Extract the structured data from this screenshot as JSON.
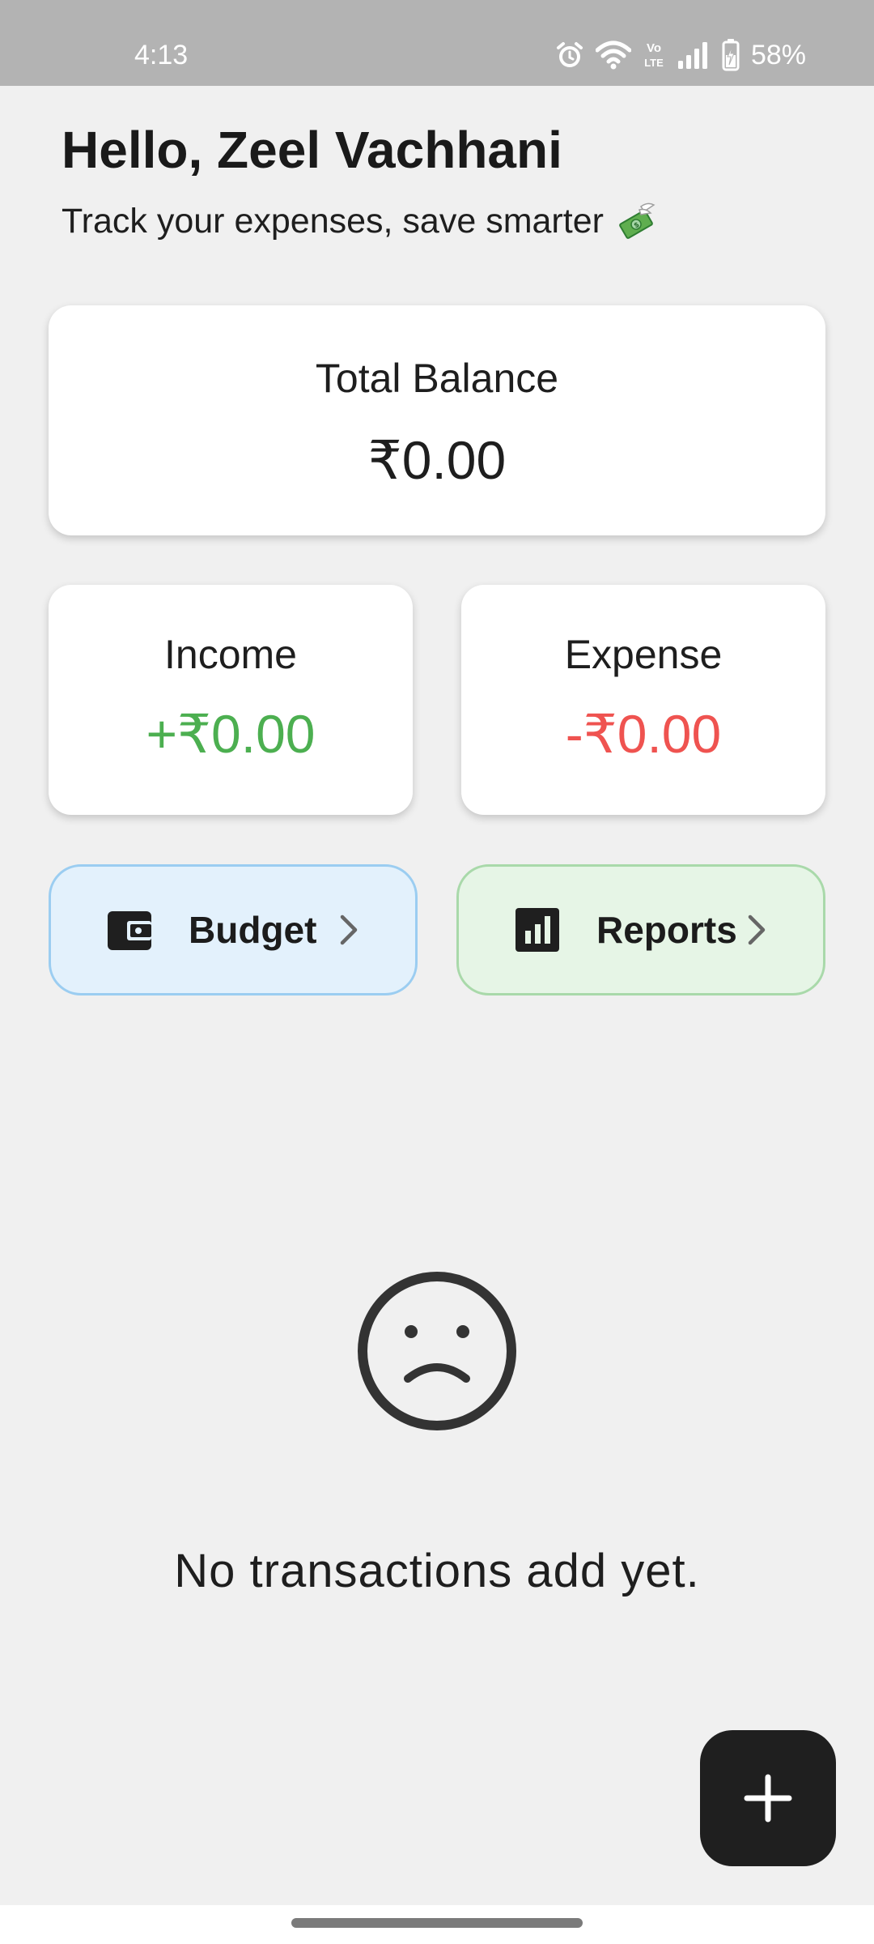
{
  "status_bar": {
    "time": "4:13",
    "battery_text": "58%",
    "network_badge_top": "Vo",
    "network_badge_bottom": "LTE",
    "icons": [
      "alarm-icon",
      "wifi-icon",
      "volte-icon",
      "signal-icon",
      "battery-charging-icon"
    ]
  },
  "greeting": {
    "title": "Hello, Zeel Vachhani",
    "subtitle": "Track your expenses, save smarter",
    "emoji_icon": "money-with-wings-icon"
  },
  "balance": {
    "label": "Total Balance",
    "amount": "₹0.00"
  },
  "income": {
    "label": "Income",
    "amount": "+₹0.00",
    "color": "#4caf50"
  },
  "expense": {
    "label": "Expense",
    "amount": "-₹0.00",
    "color": "#ef5350"
  },
  "actions": {
    "budget": {
      "label": "Budget",
      "icon": "wallet-icon",
      "background": "#e3f1fc",
      "border": "#9bcdf1"
    },
    "reports": {
      "label": "Reports",
      "icon": "bar-chart-icon",
      "background": "#e6f5e6",
      "border": "#a9d9aa"
    }
  },
  "empty_state": {
    "icon": "sad-face-icon",
    "message": "No transactions add yet."
  },
  "fab": {
    "icon": "plus-icon",
    "background": "#1f1f1f"
  }
}
